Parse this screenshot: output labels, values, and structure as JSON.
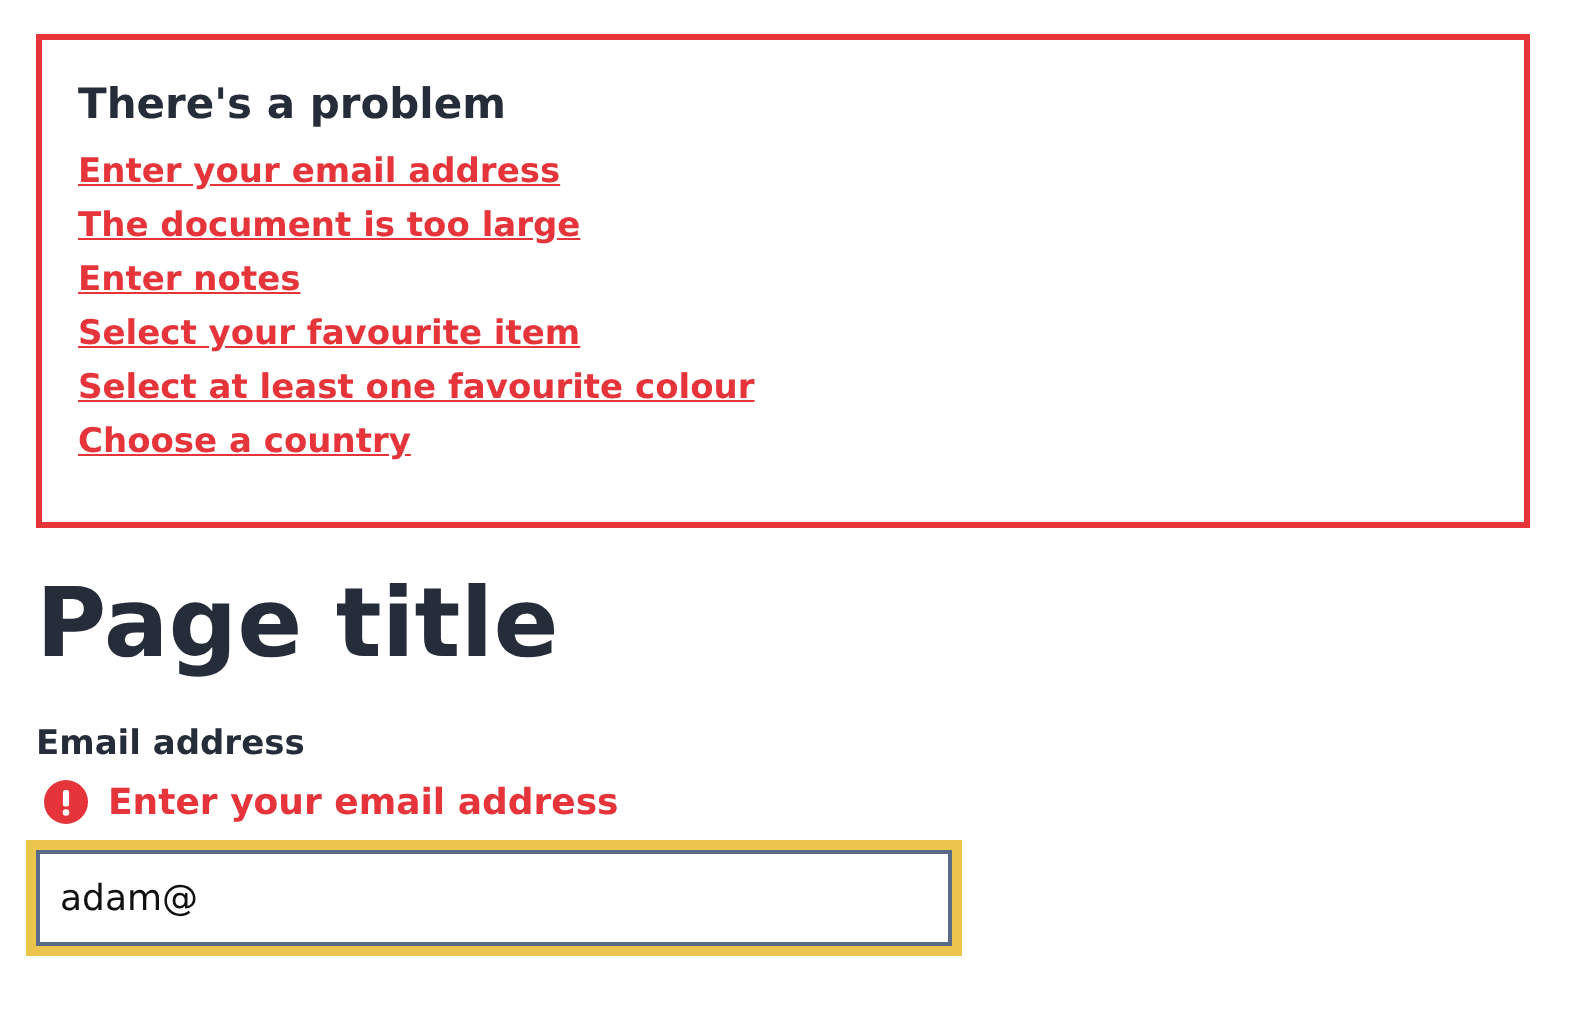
{
  "error_summary": {
    "title": "There's a problem",
    "links": [
      {
        "text": "Enter your email address"
      },
      {
        "text": "The document is too large"
      },
      {
        "text": "Enter notes"
      },
      {
        "text": "Select your favourite item"
      },
      {
        "text": "Select at least one favourite colour"
      },
      {
        "text": "Choose a country"
      }
    ]
  },
  "page_title": "Page title",
  "email_field": {
    "label": "Email address",
    "error": "Enter your email address",
    "value": "adam@",
    "focused": true
  }
}
